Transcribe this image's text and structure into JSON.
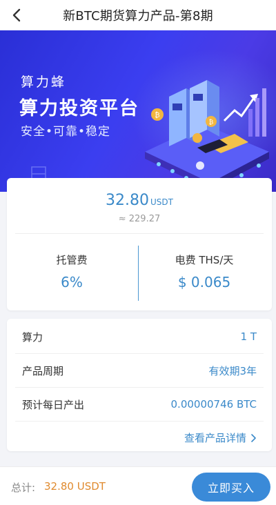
{
  "header": {
    "title": "新BTC期货算力产品-第8期"
  },
  "banner": {
    "brand": "算力蜂",
    "headline": "算力投资平台",
    "slogan": "安全•可靠•稳定"
  },
  "price": {
    "amount": "32.80",
    "unit": "USDT",
    "approx": "≈ 229.27"
  },
  "fees": {
    "custody_label": "托管费",
    "custody_value": "6%",
    "electric_label": "电费 THS/天",
    "electric_value": "$ 0.065"
  },
  "details": {
    "rows": [
      {
        "label": "算力",
        "value": "1 T"
      },
      {
        "label": "产品周期",
        "value": "有效期3年"
      },
      {
        "label": "预计每日产出",
        "value": "0.00000746 BTC"
      }
    ],
    "more_label": "查看产品详情"
  },
  "footer": {
    "total_label": "总计:",
    "total_value": "32.80 USDT",
    "buy_label": "立即买入"
  },
  "colors": {
    "accent": "#3a89c9",
    "button": "#3a8ad8",
    "total": "#e08a2e",
    "banner": "#3b3ef0"
  },
  "icons": {
    "back": "chevron-left-icon",
    "more": "chevron-right-icon"
  }
}
